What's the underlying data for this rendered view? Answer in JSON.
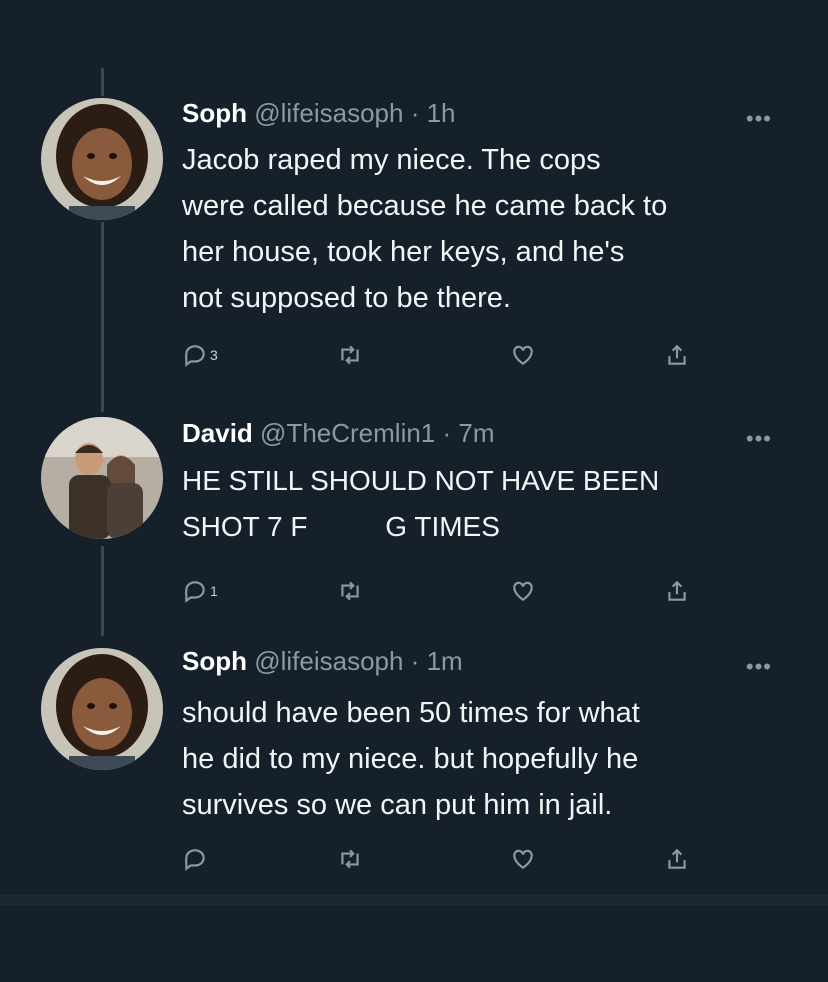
{
  "tweets": [
    {
      "name": "Soph",
      "handle": "@lifeisasoph",
      "time": "· 1h",
      "text": "Jacob raped my niece. The cops\nwere called because he came back to\nher house, took her keys, and he's\nnot supposed to be there.",
      "reply_count": "3",
      "more": "•••"
    },
    {
      "name": "David",
      "handle": "@TheCremlin1",
      "time": "· 7m",
      "text": "HE STILL SHOULD NOT HAVE BEEN\nSHOT 7 F          G TIMES",
      "reply_count": "1",
      "more": "•••"
    },
    {
      "name": "Soph",
      "handle": "@lifeisasoph",
      "time": "· 1m",
      "text": "should have been 50 times for what\nhe did to my niece. but hopefully he\nsurvives so we can put him in jail.",
      "reply_count": "",
      "more": "•••"
    }
  ],
  "icons": {
    "reply": "reply-icon",
    "retweet": "retweet-icon",
    "like": "heart-icon",
    "share": "share-icon",
    "more": "more-icon"
  },
  "colors": {
    "background": "#15202b",
    "text": "#e7e9ea",
    "secondary": "#8b98a5",
    "thread_line": "#3a4654"
  }
}
